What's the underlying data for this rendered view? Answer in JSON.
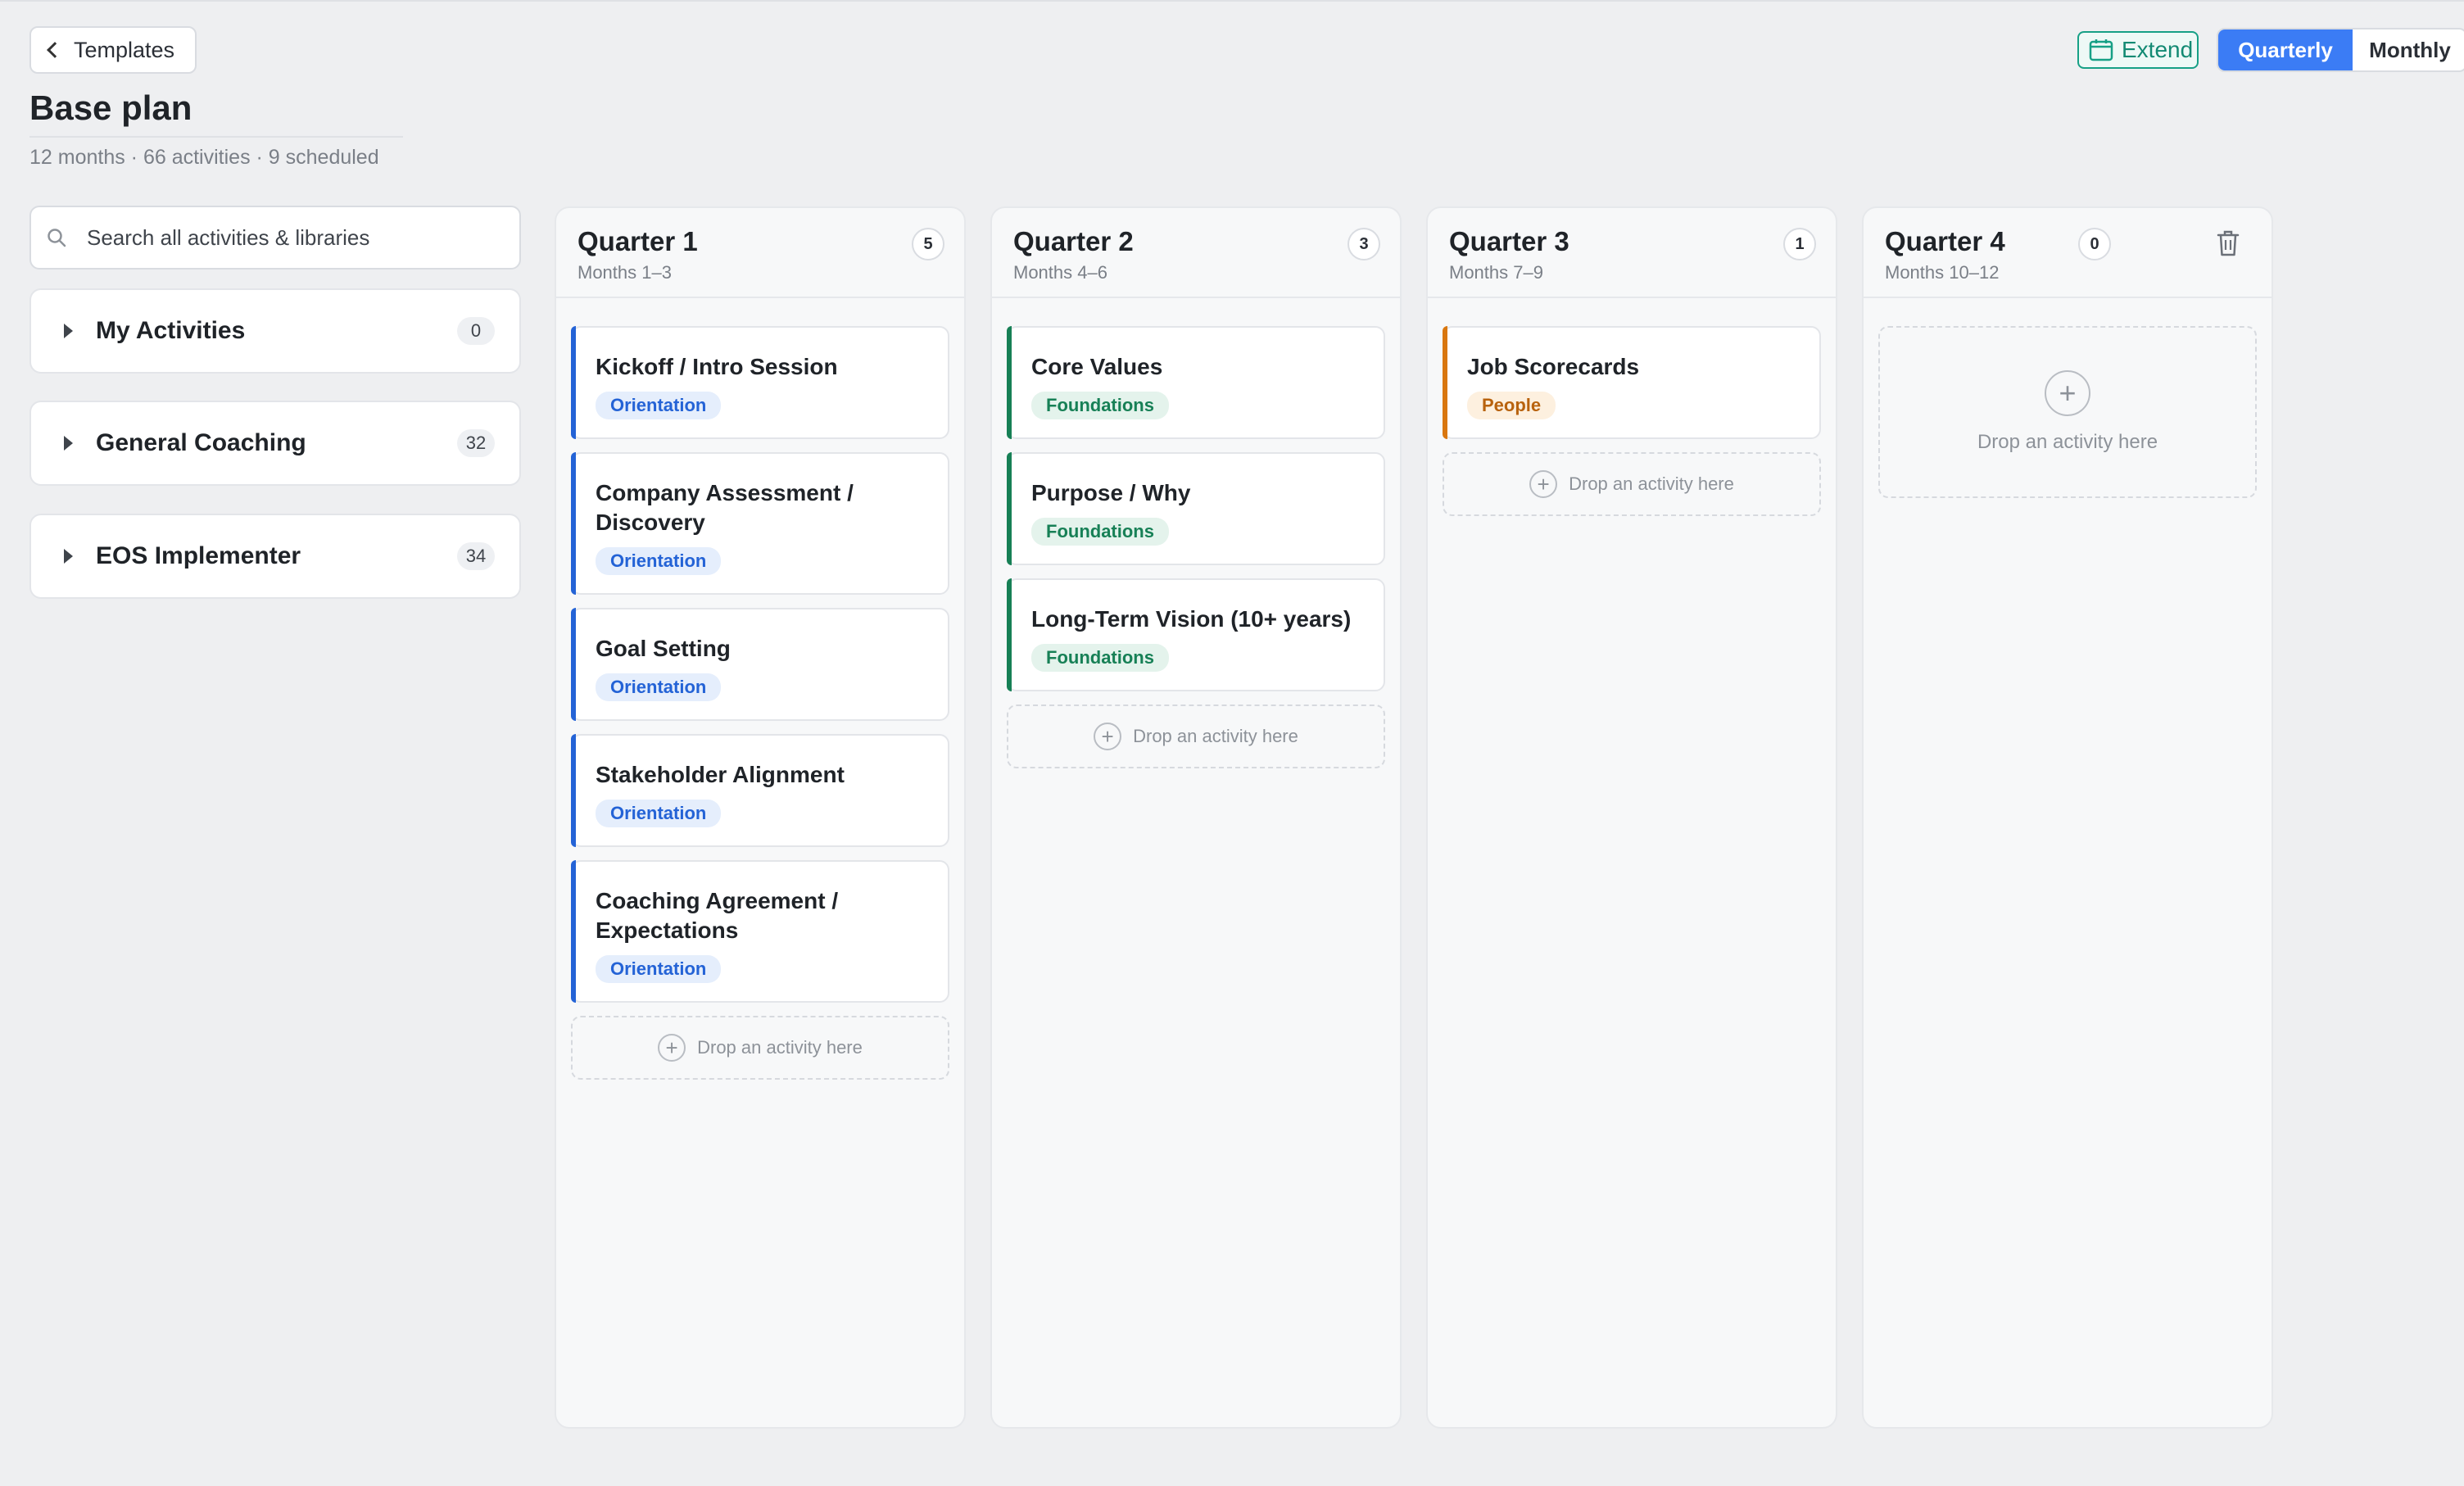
{
  "header": {
    "back_label": "Templates",
    "title": "Base plan",
    "meta": "12 months · 66 activities · 9 scheduled",
    "extend_label": "Extend",
    "view_options": [
      "Quarterly",
      "Monthly"
    ],
    "active_view": "Quarterly"
  },
  "colors": {
    "accent": "#3b7cf5",
    "extend": "#17a086",
    "orientation": "#2463d6",
    "foundations": "#178056",
    "people": "#d9770f"
  },
  "search": {
    "placeholder": "Search all activities & libraries",
    "value": ""
  },
  "libraries": [
    {
      "name": "My Activities",
      "count": "0"
    },
    {
      "name": "General Coaching",
      "count": "32"
    },
    {
      "name": "EOS Implementer",
      "count": "34"
    }
  ],
  "drop_label": "Drop an activity here",
  "quarters": [
    {
      "title": "Quarter 1",
      "months": "Months 1–3",
      "count": "5",
      "cards": [
        {
          "title": "Kickoff / Intro Session",
          "tag": "Orientation"
        },
        {
          "title": "Company Assessment / Discovery",
          "tag": "Orientation"
        },
        {
          "title": "Goal Setting",
          "tag": "Orientation"
        },
        {
          "title": "Stakeholder Alignment",
          "tag": "Orientation"
        },
        {
          "title": "Coaching Agreement / Expectations",
          "tag": "Orientation"
        }
      ]
    },
    {
      "title": "Quarter 2",
      "months": "Months 4–6",
      "count": "3",
      "cards": [
        {
          "title": "Core Values",
          "tag": "Foundations"
        },
        {
          "title": "Purpose / Why",
          "tag": "Foundations"
        },
        {
          "title": "Long-Term Vision (10+ years)",
          "tag": "Foundations"
        }
      ]
    },
    {
      "title": "Quarter 3",
      "months": "Months 7–9",
      "count": "1",
      "cards": [
        {
          "title": "Job Scorecards",
          "tag": "People"
        }
      ]
    },
    {
      "title": "Quarter 4",
      "months": "Months 10–12",
      "count": "0",
      "cards": []
    }
  ]
}
